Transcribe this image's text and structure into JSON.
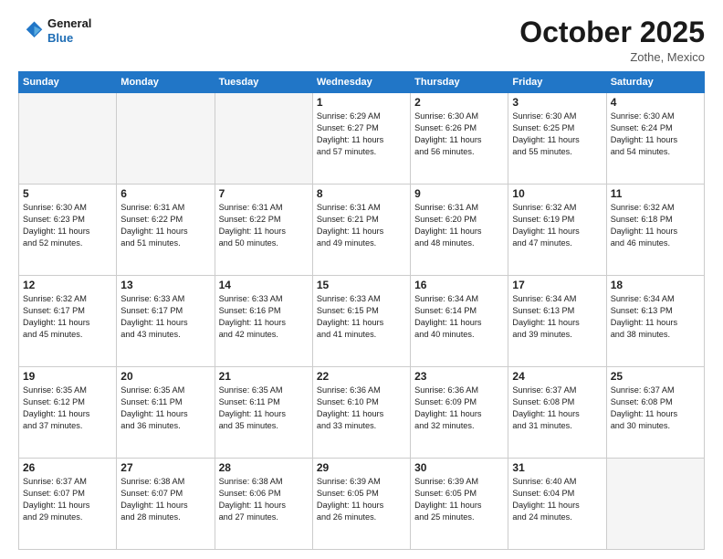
{
  "header": {
    "logo_line1": "General",
    "logo_line2": "Blue",
    "month": "October 2025",
    "location": "Zothe, Mexico"
  },
  "days_of_week": [
    "Sunday",
    "Monday",
    "Tuesday",
    "Wednesday",
    "Thursday",
    "Friday",
    "Saturday"
  ],
  "weeks": [
    [
      {
        "day": "",
        "info": ""
      },
      {
        "day": "",
        "info": ""
      },
      {
        "day": "",
        "info": ""
      },
      {
        "day": "1",
        "info": "Sunrise: 6:29 AM\nSunset: 6:27 PM\nDaylight: 11 hours\nand 57 minutes."
      },
      {
        "day": "2",
        "info": "Sunrise: 6:30 AM\nSunset: 6:26 PM\nDaylight: 11 hours\nand 56 minutes."
      },
      {
        "day": "3",
        "info": "Sunrise: 6:30 AM\nSunset: 6:25 PM\nDaylight: 11 hours\nand 55 minutes."
      },
      {
        "day": "4",
        "info": "Sunrise: 6:30 AM\nSunset: 6:24 PM\nDaylight: 11 hours\nand 54 minutes."
      }
    ],
    [
      {
        "day": "5",
        "info": "Sunrise: 6:30 AM\nSunset: 6:23 PM\nDaylight: 11 hours\nand 52 minutes."
      },
      {
        "day": "6",
        "info": "Sunrise: 6:31 AM\nSunset: 6:22 PM\nDaylight: 11 hours\nand 51 minutes."
      },
      {
        "day": "7",
        "info": "Sunrise: 6:31 AM\nSunset: 6:22 PM\nDaylight: 11 hours\nand 50 minutes."
      },
      {
        "day": "8",
        "info": "Sunrise: 6:31 AM\nSunset: 6:21 PM\nDaylight: 11 hours\nand 49 minutes."
      },
      {
        "day": "9",
        "info": "Sunrise: 6:31 AM\nSunset: 6:20 PM\nDaylight: 11 hours\nand 48 minutes."
      },
      {
        "day": "10",
        "info": "Sunrise: 6:32 AM\nSunset: 6:19 PM\nDaylight: 11 hours\nand 47 minutes."
      },
      {
        "day": "11",
        "info": "Sunrise: 6:32 AM\nSunset: 6:18 PM\nDaylight: 11 hours\nand 46 minutes."
      }
    ],
    [
      {
        "day": "12",
        "info": "Sunrise: 6:32 AM\nSunset: 6:17 PM\nDaylight: 11 hours\nand 45 minutes."
      },
      {
        "day": "13",
        "info": "Sunrise: 6:33 AM\nSunset: 6:17 PM\nDaylight: 11 hours\nand 43 minutes."
      },
      {
        "day": "14",
        "info": "Sunrise: 6:33 AM\nSunset: 6:16 PM\nDaylight: 11 hours\nand 42 minutes."
      },
      {
        "day": "15",
        "info": "Sunrise: 6:33 AM\nSunset: 6:15 PM\nDaylight: 11 hours\nand 41 minutes."
      },
      {
        "day": "16",
        "info": "Sunrise: 6:34 AM\nSunset: 6:14 PM\nDaylight: 11 hours\nand 40 minutes."
      },
      {
        "day": "17",
        "info": "Sunrise: 6:34 AM\nSunset: 6:13 PM\nDaylight: 11 hours\nand 39 minutes."
      },
      {
        "day": "18",
        "info": "Sunrise: 6:34 AM\nSunset: 6:13 PM\nDaylight: 11 hours\nand 38 minutes."
      }
    ],
    [
      {
        "day": "19",
        "info": "Sunrise: 6:35 AM\nSunset: 6:12 PM\nDaylight: 11 hours\nand 37 minutes."
      },
      {
        "day": "20",
        "info": "Sunrise: 6:35 AM\nSunset: 6:11 PM\nDaylight: 11 hours\nand 36 minutes."
      },
      {
        "day": "21",
        "info": "Sunrise: 6:35 AM\nSunset: 6:11 PM\nDaylight: 11 hours\nand 35 minutes."
      },
      {
        "day": "22",
        "info": "Sunrise: 6:36 AM\nSunset: 6:10 PM\nDaylight: 11 hours\nand 33 minutes."
      },
      {
        "day": "23",
        "info": "Sunrise: 6:36 AM\nSunset: 6:09 PM\nDaylight: 11 hours\nand 32 minutes."
      },
      {
        "day": "24",
        "info": "Sunrise: 6:37 AM\nSunset: 6:08 PM\nDaylight: 11 hours\nand 31 minutes."
      },
      {
        "day": "25",
        "info": "Sunrise: 6:37 AM\nSunset: 6:08 PM\nDaylight: 11 hours\nand 30 minutes."
      }
    ],
    [
      {
        "day": "26",
        "info": "Sunrise: 6:37 AM\nSunset: 6:07 PM\nDaylight: 11 hours\nand 29 minutes."
      },
      {
        "day": "27",
        "info": "Sunrise: 6:38 AM\nSunset: 6:07 PM\nDaylight: 11 hours\nand 28 minutes."
      },
      {
        "day": "28",
        "info": "Sunrise: 6:38 AM\nSunset: 6:06 PM\nDaylight: 11 hours\nand 27 minutes."
      },
      {
        "day": "29",
        "info": "Sunrise: 6:39 AM\nSunset: 6:05 PM\nDaylight: 11 hours\nand 26 minutes."
      },
      {
        "day": "30",
        "info": "Sunrise: 6:39 AM\nSunset: 6:05 PM\nDaylight: 11 hours\nand 25 minutes."
      },
      {
        "day": "31",
        "info": "Sunrise: 6:40 AM\nSunset: 6:04 PM\nDaylight: 11 hours\nand 24 minutes."
      },
      {
        "day": "",
        "info": ""
      }
    ]
  ]
}
